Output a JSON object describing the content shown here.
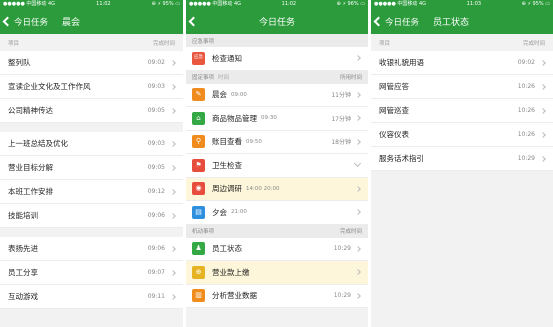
{
  "screen1": {
    "status": {
      "carrier": "●●●●● 中国移动  4G",
      "time": "11:02",
      "battery": "⊕ ⚡ 95% ▭"
    },
    "nav": {
      "back_label": "今日任务",
      "title": "晨会"
    },
    "header": {
      "left": "项目",
      "right": "完成时间"
    },
    "groups": [
      [
        {
          "label": "整列队",
          "time": "09:02"
        },
        {
          "label": "宣读企业文化及工作作风",
          "time": "09:03"
        },
        {
          "label": "公司精神传达",
          "time": "09:05"
        }
      ],
      [
        {
          "label": "上一班总结及优化",
          "time": "09:03"
        },
        {
          "label": "营业目标分解",
          "time": "09:05"
        },
        {
          "label": "本班工作安排",
          "time": "09:12"
        },
        {
          "label": "技能培训",
          "time": "09:06"
        }
      ],
      [
        {
          "label": "表扬先进",
          "time": "09:06"
        },
        {
          "label": "员工分享",
          "time": "09:07"
        },
        {
          "label": "互动游戏",
          "time": "09:11"
        }
      ]
    ]
  },
  "screen2": {
    "status": {
      "carrier": "●●●●● 中国移动  4G",
      "time": "11:02",
      "battery": "⊕ ⚡ 96% ▭"
    },
    "nav": {
      "title": "今日任务"
    },
    "sections": {
      "emergency": {
        "title": "应急事项"
      },
      "fixed": {
        "title": "固定事项",
        "time": "时间",
        "right": "所用时间"
      },
      "mobile": {
        "title": "机动事项",
        "right": "完成时间"
      }
    },
    "emergency_items": [
      {
        "icon_text": "应急",
        "label": "检查通知",
        "sub": "",
        "time": ""
      }
    ],
    "fixed_items": [
      {
        "icon_text": "✎",
        "label": "晨会",
        "sub": "09:00",
        "time": "11分钟"
      },
      {
        "icon_text": "⌂",
        "label": "商品物品管理",
        "sub": "09:30",
        "time": "17分钟"
      },
      {
        "icon_text": "⚲",
        "label": "账目查看",
        "sub": "09:50",
        "time": "18分钟"
      },
      {
        "icon_text": "⚑",
        "label": "卫生检查",
        "sub": "",
        "time": ""
      },
      {
        "icon_text": "◉",
        "label": "周边调研",
        "sub": "14:00 20:00",
        "time": ""
      },
      {
        "icon_text": "▤",
        "label": "夕会",
        "sub": "21:00",
        "time": ""
      }
    ],
    "mobile_items": [
      {
        "icon_text": "♟",
        "label": "员工状态",
        "sub": "",
        "time": "10:29"
      },
      {
        "icon_text": "⊕",
        "label": "营业款上缴",
        "sub": "",
        "time": ""
      },
      {
        "icon_text": "▥",
        "label": "分析营业数据",
        "sub": "",
        "time": "10:29"
      }
    ],
    "icon_colors": {
      "emergency": "#e9573f",
      "green": "#33a844",
      "orange": "#f08c1e",
      "red": "#e74c3c",
      "blue": "#2f8fdf",
      "yellow": "#e6b422"
    }
  },
  "screen3": {
    "status": {
      "carrier": "●●●●● 中国移动  4G",
      "time": "11:03",
      "battery": "⊕ ⚡ 95% ▭"
    },
    "nav": {
      "back_label": "今日任务",
      "title": "员工状态"
    },
    "header": {
      "left": "项目",
      "right": "完成时间"
    },
    "items": [
      {
        "label": "收银礼貌用语",
        "time": "09:02"
      },
      {
        "label": "网管应答",
        "time": "10:26"
      },
      {
        "label": "网管巡查",
        "time": "10:26"
      },
      {
        "label": "仪容仪表",
        "time": "10:26"
      },
      {
        "label": "服务话术指引",
        "time": "10:29"
      }
    ]
  },
  "theme": {
    "primary": "#2b9b3b",
    "highlight": "#fdf6da"
  }
}
